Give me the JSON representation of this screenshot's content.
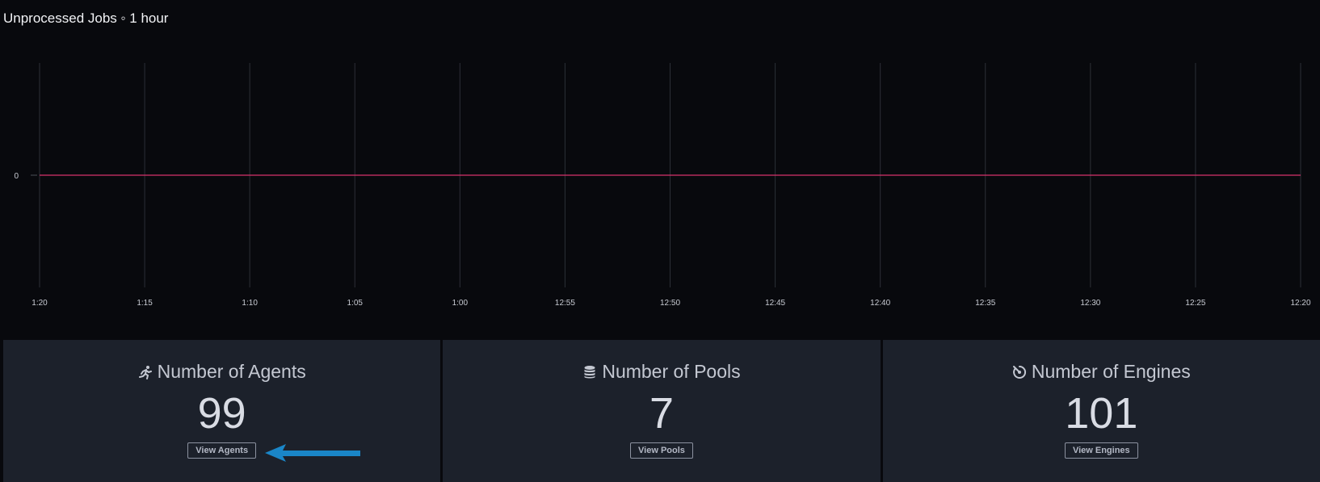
{
  "chart": {
    "title": "Unprocessed Jobs ◦ 1 hour"
  },
  "chart_data": {
    "type": "line",
    "title": "Unprocessed Jobs ◦ 1 hour",
    "x_tick_labels": [
      "1:20",
      "1:15",
      "1:10",
      "1:05",
      "1:00",
      "12:55",
      "12:50",
      "12:45",
      "12:40",
      "12:35",
      "12:30",
      "12:25",
      "12:20"
    ],
    "y_tick_labels": [
      "0"
    ],
    "series": [
      {
        "values": [
          0,
          0,
          0,
          0,
          0,
          0,
          0,
          0,
          0,
          0,
          0,
          0,
          0
        ],
        "color": "#d6336c"
      }
    ],
    "grid": "vertical",
    "xlabel": "",
    "ylabel": ""
  },
  "cards": [
    {
      "icon": "running-person-icon",
      "label": "Number of Agents",
      "value": "99",
      "button": "View Agents"
    },
    {
      "icon": "database-icon",
      "label": "Number of Pools",
      "value": "7",
      "button": "View Pools"
    },
    {
      "icon": "engine-gauge-icon",
      "label": "Number of Engines",
      "value": "101",
      "button": "View Engines"
    }
  ],
  "colors": {
    "background": "#08090d",
    "card_background": "#1c212b",
    "series_line": "#d6336c",
    "arrow": "#1a86c8"
  }
}
